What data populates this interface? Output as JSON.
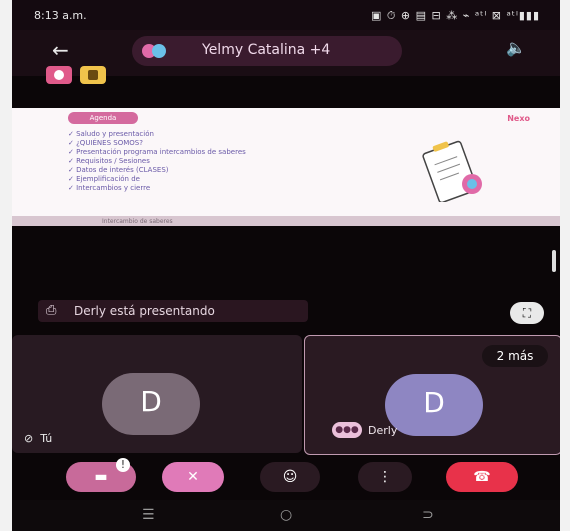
{
  "status_bar": {
    "time": "8:13 a.m.",
    "icons_text": "▣ ⏱ ⊕ ▤   ⊟ ⁂ ⌁ ᵃᵗˡ ⊠ ᵃᵗˡ▮▮▮"
  },
  "call_header": {
    "back_icon": "←",
    "participants_title": "Yelmy Catalina +4",
    "speaker_icon": "🔈"
  },
  "toolbar_chips": {
    "record_chip_color": "#e05a8a",
    "emoji_chip_color": "#f0c34b"
  },
  "presentation": {
    "badge_label": "Agenda",
    "logo_text": "Nexo",
    "items": [
      "✓ Saludo y presentación",
      "✓ ¿QUIÉNES SOMOS?",
      "✓ Presentación programa intercambios de saberes",
      "✓ Requisitos / Sesiones",
      "✓ Datos de interés (CLASES)",
      "✓ Ejemplificación de",
      "✓ Intercambios y cierre"
    ],
    "footer_text": "Intercambio de saberes"
  },
  "presenting_banner": {
    "text": "Derly está presentando"
  },
  "tiles": {
    "you_label": "Tú",
    "you_initial": "D",
    "derly_initial": "D",
    "derly_label": "Derly",
    "more_label": "2 más"
  },
  "controls": {
    "camera_badge": "!",
    "hangup_icon": "☎"
  },
  "nav": {
    "recents": "☰",
    "home": "○",
    "back": "⊃"
  },
  "colors": {
    "accent_pink": "#e05a8a",
    "tile_bg": "#281a22",
    "you_avatar": "#7a6a76",
    "derly_avatar": "#8e86c2",
    "hangup_red": "#e8324a"
  }
}
